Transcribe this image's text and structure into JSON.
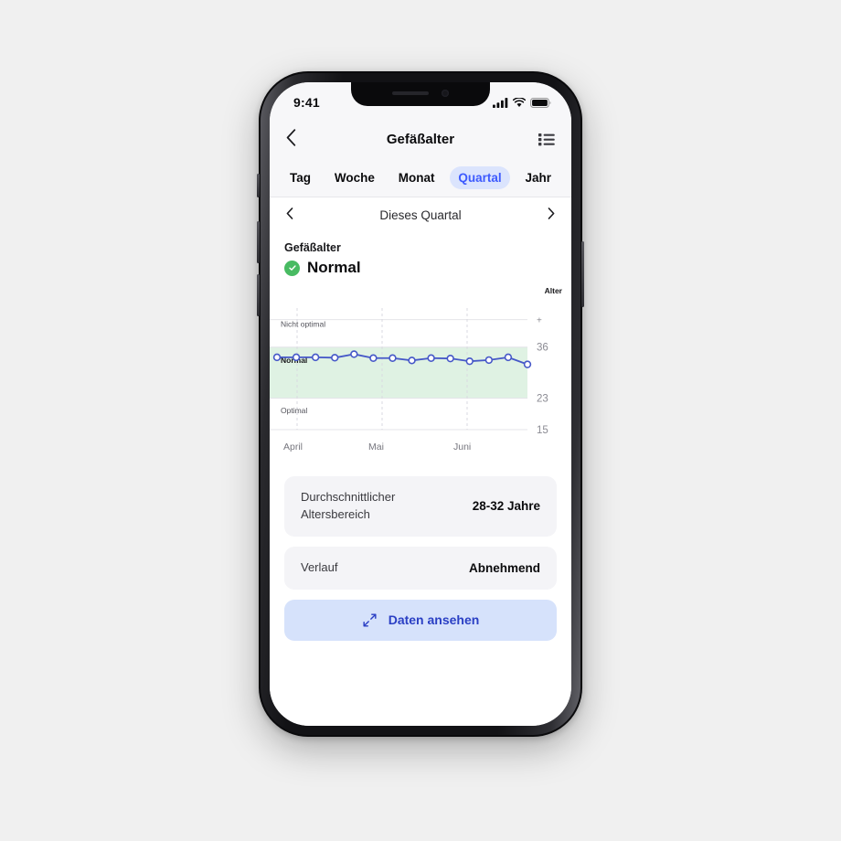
{
  "status_bar": {
    "time": "9:41",
    "icons": [
      "signal-bars-icon",
      "wifi-icon",
      "battery-icon"
    ]
  },
  "nav": {
    "back_icon": "chevron-left-icon",
    "title": "Gefäßalter",
    "list_icon": "list-bullet-icon"
  },
  "tabs": [
    {
      "label": "Tag",
      "active": false
    },
    {
      "label": "Woche",
      "active": false
    },
    {
      "label": "Monat",
      "active": false
    },
    {
      "label": "Quartal",
      "active": true
    },
    {
      "label": "Jahr",
      "active": false
    }
  ],
  "period": {
    "prev_icon": "chevron-left-icon",
    "label": "Dieses Quartal",
    "next_icon": "chevron-right-icon"
  },
  "summary": {
    "label": "Gefäßalter",
    "badge_icon": "check-circle-icon",
    "value": "Normal",
    "badge_color": "#48bb62"
  },
  "chart_data": {
    "type": "line",
    "title": "",
    "ylabel": "Alter",
    "xlabel": "",
    "grid": true,
    "legend": "none",
    "line_color": "#4658c8",
    "marker_fill": "#ffffff",
    "band_color": "#dff2e3",
    "categories": [
      "April",
      "Mai",
      "Juni"
    ],
    "x_tick_labels": [
      "April",
      "Mai",
      "Juni"
    ],
    "y_tick_labels": [
      "+",
      "36",
      "23",
      "15"
    ],
    "ylim": [
      15,
      45
    ],
    "band_labels": [
      "Nicht optimal",
      "Normal",
      "Optimal"
    ],
    "normal_band": [
      23,
      36
    ],
    "x": [
      1,
      2,
      3,
      4,
      5,
      6,
      7,
      8,
      9,
      10,
      11,
      12,
      13,
      14
    ],
    "values": [
      33.4,
      33.4,
      33.4,
      33.3,
      34.2,
      33.2,
      33.2,
      32.6,
      33.2,
      33.1,
      32.4,
      32.7,
      33.4,
      31.6
    ]
  },
  "cards": [
    {
      "label": "Durchschnittlicher Altersbereich",
      "value": "28-32 Jahre"
    },
    {
      "label": "Verlauf",
      "value": "Abnehmend"
    }
  ],
  "action": {
    "icon": "expand-arrows-icon",
    "label": "Daten ansehen"
  }
}
